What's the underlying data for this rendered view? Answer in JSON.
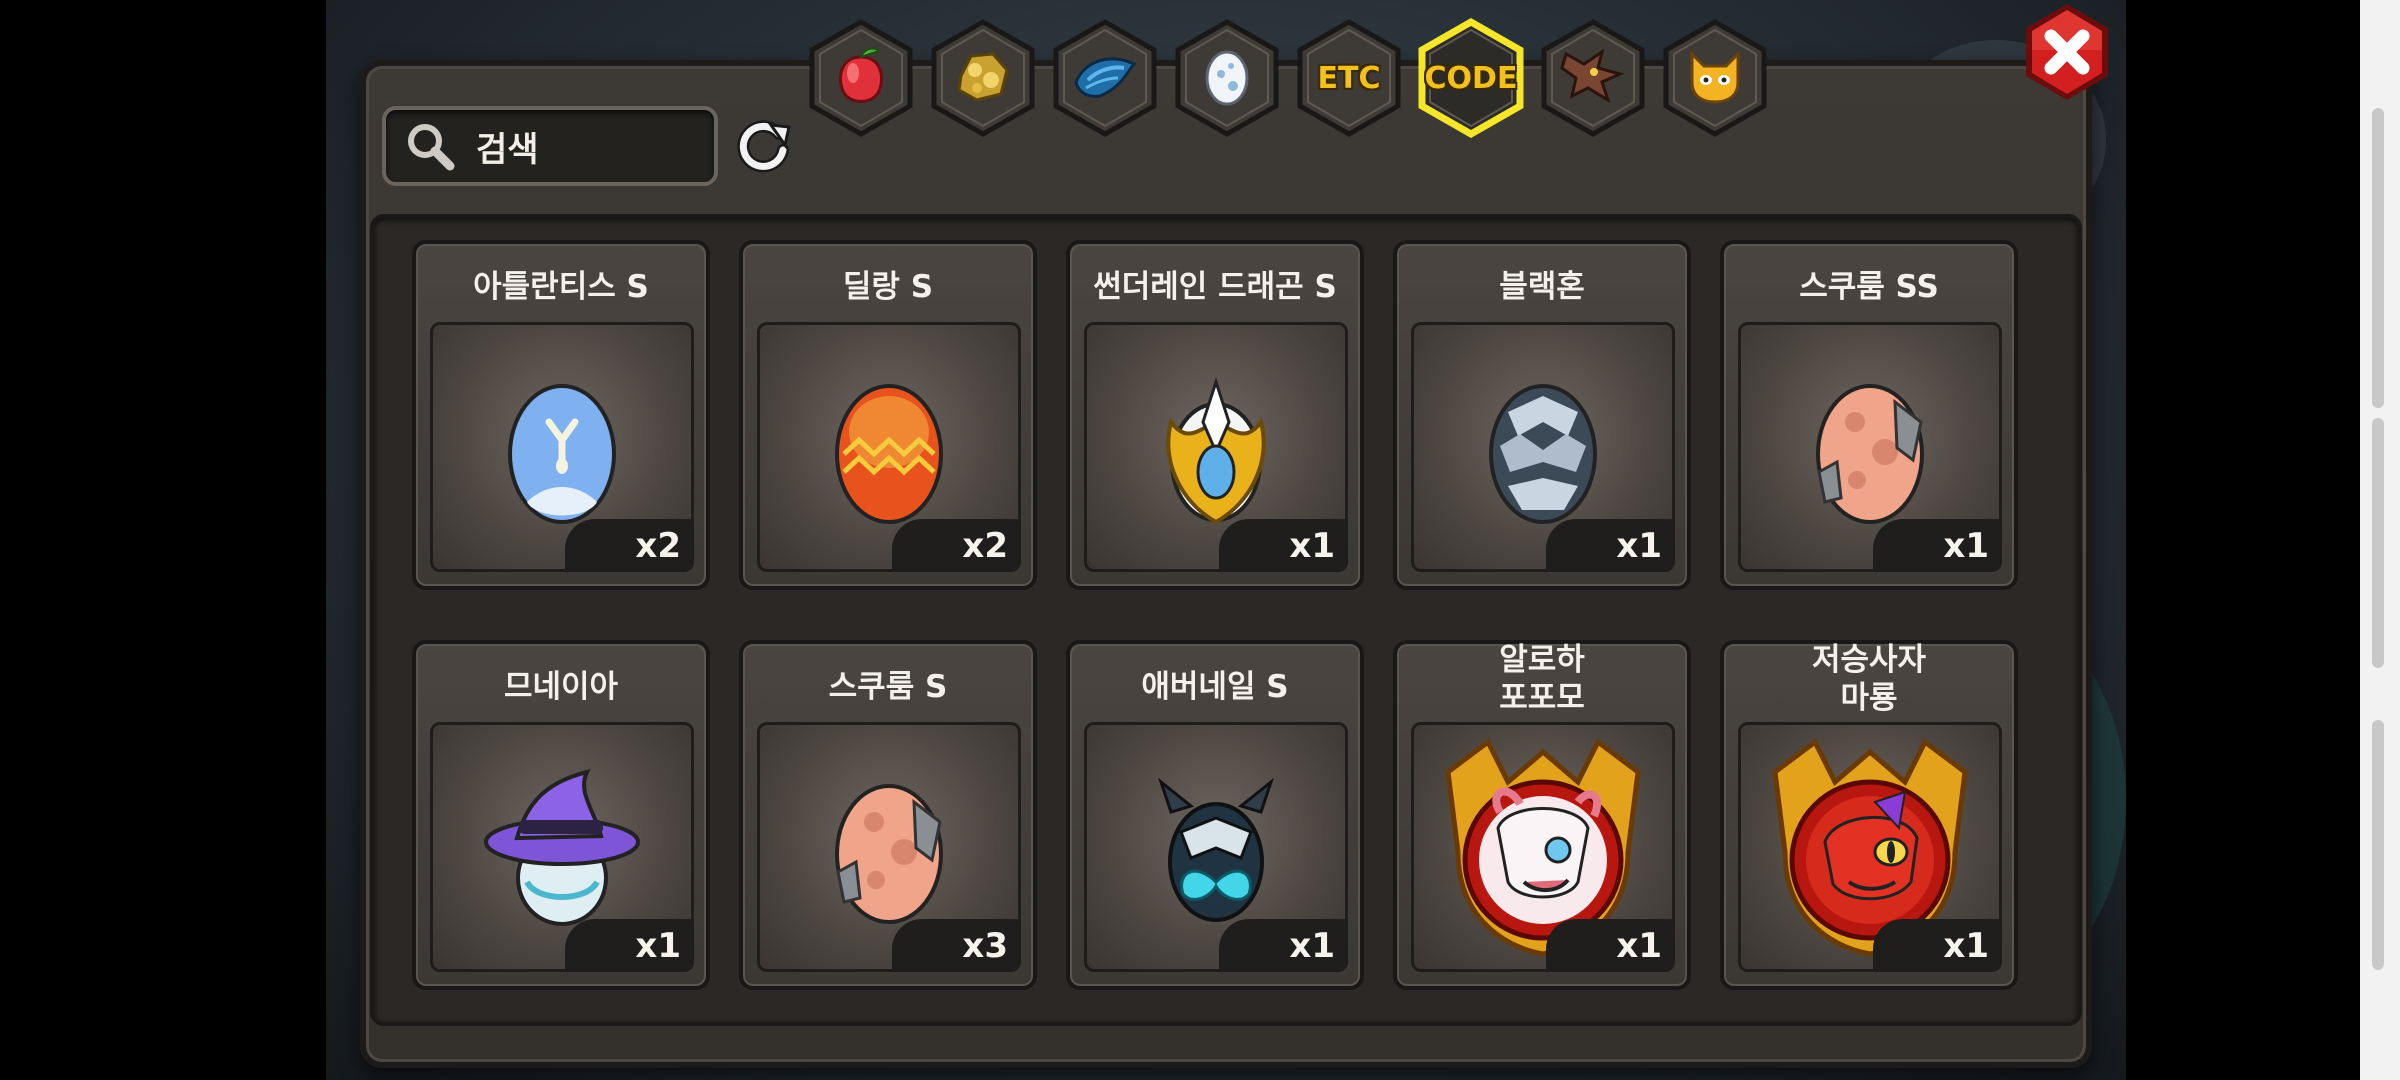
{
  "search": {
    "placeholder": "검색"
  },
  "tabs": [
    {
      "id": "fruit",
      "icon": "fruit-icon",
      "label": ""
    },
    {
      "id": "ore",
      "icon": "gold-ore-icon",
      "label": ""
    },
    {
      "id": "scale",
      "icon": "dragon-scale-icon",
      "label": ""
    },
    {
      "id": "egg",
      "icon": "egg-icon",
      "label": ""
    },
    {
      "id": "etc",
      "icon": "",
      "label": "ETC"
    },
    {
      "id": "code",
      "icon": "",
      "label": "CODE",
      "selected": true
    },
    {
      "id": "beast",
      "icon": "beast-head-icon",
      "label": ""
    },
    {
      "id": "mascot",
      "icon": "mascot-face-icon",
      "label": ""
    }
  ],
  "items": [
    {
      "name": "아틀란티스 S",
      "qty": "x2",
      "art": "blue-egg"
    },
    {
      "name": "딜랑 S",
      "qty": "x2",
      "art": "orange-egg"
    },
    {
      "name": "썬더레인 드래곤 S",
      "qty": "x1",
      "art": "gold-dragon-egg"
    },
    {
      "name": "블랙혼",
      "qty": "x1",
      "art": "silver-spiked-egg"
    },
    {
      "name": "스쿠룸 SS",
      "qty": "x1",
      "art": "spotted-egg"
    },
    {
      "name": "므네이아",
      "qty": "x1",
      "art": "witch-hat-egg"
    },
    {
      "name": "스쿠룸 S",
      "qty": "x3",
      "art": "spotted-egg"
    },
    {
      "name": "애버네일 S",
      "qty": "x1",
      "art": "dark-butterfly-egg"
    },
    {
      "name": "알로하\n포포모",
      "qty": "x1",
      "art": "pink-dragon-medallion"
    },
    {
      "name": "저승사자\n마룡",
      "qty": "x1",
      "art": "red-dragon-medallion"
    }
  ],
  "colors": {
    "selected_tab_glow": "#f5e62a",
    "close_red": "#d21f1f",
    "tab_text": "#f2c11e"
  }
}
